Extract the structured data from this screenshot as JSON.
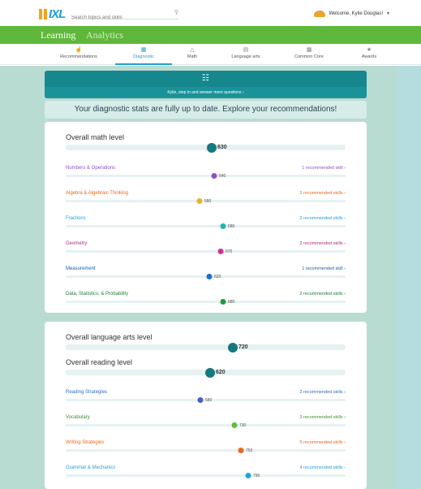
{
  "header": {
    "logo": "IXL",
    "search_placeholder": "Search topics and skills",
    "welcome": "Welcome, Kylie Douglas!"
  },
  "nav": {
    "learning": "Learning",
    "analytics": "Analytics"
  },
  "subnav": [
    {
      "label": "Recommendations",
      "icon": "thumbs-up-icon"
    },
    {
      "label": "Diagnostic",
      "icon": "diagnostic-icon",
      "active": true
    },
    {
      "label": "Math",
      "icon": "math-icon"
    },
    {
      "label": "Language arts",
      "icon": "book-icon"
    },
    {
      "label": "Common Core",
      "icon": "common-core-icon"
    },
    {
      "label": "Awards",
      "icon": "awards-icon"
    }
  ],
  "banner": {
    "text": "Kylie, step in and answer more questions ›"
  },
  "stats_strip": "Your diagnostic stats are fully up to date. Explore your recommendations!",
  "math": {
    "overall": {
      "label": "Overall math level",
      "value": "630",
      "color": "#157a7f"
    },
    "skills": [
      {
        "label": "Numbers & Operations",
        "value": "640",
        "rec": "1 recommended skill ›",
        "color": "#8d4fc4"
      },
      {
        "label": "Algebra & Algebraic Thinking",
        "value": "580",
        "rec": "3 recommended skills ›",
        "color": "#e8b521"
      },
      {
        "label": "Fractions",
        "value": "680",
        "rec": "2 recommended skills ›",
        "color": "#1eb3b6"
      },
      {
        "label": "Geometry",
        "value": "670",
        "rec": "2 recommended skills ›",
        "color": "#d72f94"
      },
      {
        "label": "Measurement",
        "value": "620",
        "rec": "1 recommended skill ›",
        "color": "#1b6fd1"
      },
      {
        "label": "Data, Statistics, & Probability",
        "value": "680",
        "rec": "2 recommended skills ›",
        "color": "#1f9b3e"
      }
    ]
  },
  "lang": {
    "overall": {
      "label": "Overall language arts level",
      "value": "720",
      "color": "#157a7f"
    },
    "reading": {
      "label": "Overall reading level",
      "value": "620",
      "color": "#157a7f"
    },
    "skills": [
      {
        "label": "Reading Strategies",
        "value": "580",
        "rec": "2 recommended skills ›",
        "color": "#4a5ad4"
      },
      {
        "label": "Vocabulary",
        "value": "730",
        "rec": "3 recommended skills ›",
        "color": "#5bbf3b"
      },
      {
        "label": "Writing Strategies",
        "value": "750",
        "rec": "5 recommended skills ›",
        "color": "#e8681f"
      },
      {
        "label": "Grammar & Mechanics",
        "value": "790",
        "rec": "4 recommended skills ›",
        "color": "#1fa6d6"
      }
    ]
  }
}
